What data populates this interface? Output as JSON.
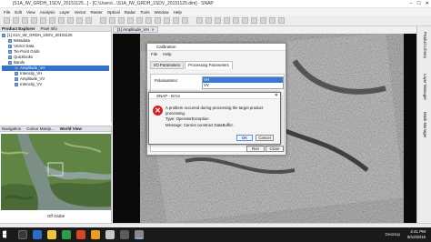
{
  "window": {
    "title": "[S1A_IW_GRDH_1SDV_20151125...] - [C:\\Users\\...\\S1A_IW_GRDH_1SDV_20151125.dim] - SNAP",
    "controls": [
      "–",
      "☐",
      "✕"
    ]
  },
  "menubar": [
    "File",
    "Edit",
    "View",
    "Analysis",
    "Layer",
    "Vector",
    "Raster",
    "Optical",
    "Radar",
    "Tools",
    "Window",
    "Help"
  ],
  "product_explorer": {
    "tabs": [
      "Product Explorer",
      "Pixel Info"
    ],
    "items": [
      {
        "label": "[1] S1A_IW_GRDH_1SDV_20151125",
        "indent": 0,
        "selected": false
      },
      {
        "label": "Metadata",
        "indent": 1,
        "selected": false
      },
      {
        "label": "Vector Data",
        "indent": 1,
        "selected": false
      },
      {
        "label": "Tie-Point Grids",
        "indent": 1,
        "selected": false
      },
      {
        "label": "Quicklooks",
        "indent": 1,
        "selected": false
      },
      {
        "label": "Bands",
        "indent": 1,
        "selected": false
      },
      {
        "label": "Amplitude_VH",
        "indent": 2,
        "selected": true
      },
      {
        "label": "Intensity_VH",
        "indent": 2,
        "selected": false
      },
      {
        "label": "Amplitude_VV",
        "indent": 2,
        "selected": false
      },
      {
        "label": "Intensity_VV",
        "indent": 2,
        "selected": false
      }
    ]
  },
  "navigation": {
    "tabs": [
      "Navigation",
      "Colour Manip...",
      "World View"
    ],
    "footer": "Off Globe"
  },
  "image_view": {
    "tab": "[1] Amplitude_VH"
  },
  "side_tabs": [
    "Product Library",
    "Layer Manager",
    "Mask Manager"
  ],
  "calibration_dialog": {
    "title": "Calibration",
    "menu": [
      "File",
      "Help"
    ],
    "tabs": [
      "I/O Parameters",
      "Processing Parameters"
    ],
    "polarisations_label": "Polarisations:",
    "polarisations": [
      {
        "value": "VH",
        "selected": true
      },
      {
        "value": "VV",
        "selected": false
      }
    ],
    "run_label": "Run",
    "close_label": "Close"
  },
  "error_dialog": {
    "title": "SNAP - Error",
    "lines": [
      "A problem occurred during processing the target product processing.",
      "Type: OperatorException",
      "Message: Cannot construct DataBuffer."
    ],
    "ok_label": "OK",
    "cancel_label": "Cancel"
  },
  "taskbar": {
    "desktop_label": "Desktop",
    "time": "4:41 PM",
    "date": "9/12/2016"
  }
}
